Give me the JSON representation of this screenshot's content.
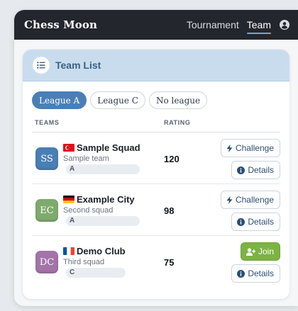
{
  "app": {
    "brand": "Chess Moon",
    "nav": [
      {
        "label": "Tournament",
        "active": false
      },
      {
        "label": "Team",
        "active": true
      }
    ],
    "user_icon": "user-circle-icon"
  },
  "team_list": {
    "title": "Team List",
    "title_icon": "list-icon",
    "filters": [
      {
        "label": "League A",
        "active": true
      },
      {
        "label": "League C",
        "active": false
      },
      {
        "label": "No league",
        "active": false
      }
    ],
    "columns": {
      "teams": "TEAMS",
      "rating": "RATING"
    },
    "rows": [
      {
        "initials": "SS",
        "avatar_color": "#4a7fb5",
        "flag": "turkey",
        "name": "Sample Squad",
        "description": "Sample team",
        "league": "A",
        "rating": "120",
        "primary_action": {
          "label": "Challenge",
          "icon": "bolt-icon",
          "type": "challenge"
        },
        "secondary_action": {
          "label": "Details",
          "icon": "info-icon"
        }
      },
      {
        "initials": "EC",
        "avatar_color": "#7faa6e",
        "flag": "germany",
        "name": "Example City",
        "description": "Second squad",
        "league": "A",
        "rating": "98",
        "primary_action": {
          "label": "Challenge",
          "icon": "bolt-icon",
          "type": "challenge"
        },
        "secondary_action": {
          "label": "Details",
          "icon": "info-icon"
        }
      },
      {
        "initials": "DC",
        "avatar_color": "#a374a8",
        "flag": "france",
        "name": "Demo Club",
        "description": "Third squad",
        "league": "C",
        "rating": "75",
        "primary_action": {
          "label": "Join",
          "icon": "user-plus-icon",
          "type": "join"
        },
        "secondary_action": {
          "label": "Details",
          "icon": "info-icon"
        }
      }
    ]
  },
  "colors": {
    "topbar": "#23262d",
    "accent": "#4a7fb5",
    "header_band": "#c9dcee",
    "join_green": "#7cb342"
  }
}
